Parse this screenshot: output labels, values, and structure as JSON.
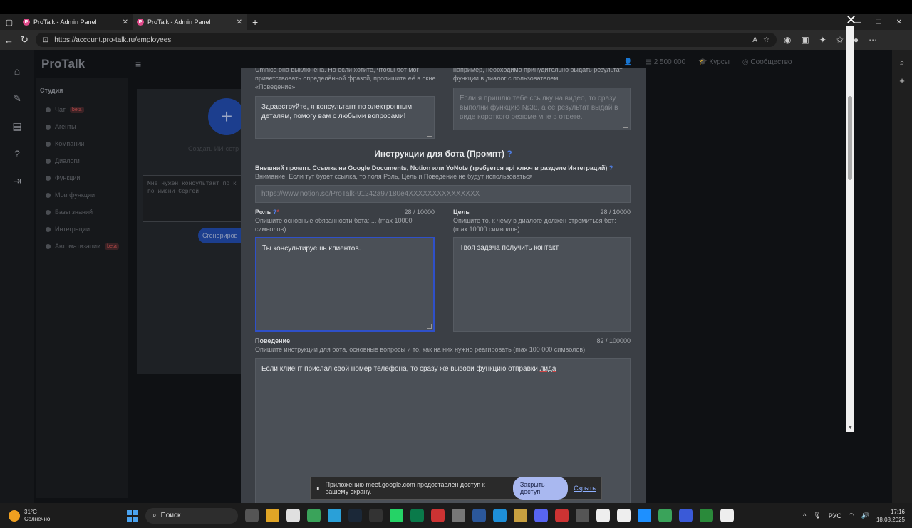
{
  "browser": {
    "tabs": [
      {
        "title": "ProTalk - Admin Panel",
        "active": false
      },
      {
        "title": "ProTalk - Admin Panel",
        "active": true
      }
    ],
    "url": "https://account.pro-talk.ru/employees"
  },
  "app": {
    "logo": "ProTalk",
    "sidebar": {
      "section": "Студия",
      "items": [
        {
          "label": "Чат",
          "badge": "beta"
        },
        {
          "label": "Агенты"
        },
        {
          "label": "Компании"
        },
        {
          "label": "Диалоги"
        },
        {
          "label": "Функции"
        },
        {
          "label": "Мои функции"
        },
        {
          "label": "Базы знаний"
        },
        {
          "label": "Интеграции"
        },
        {
          "label": "Автоматизации",
          "badge": "beta"
        }
      ]
    },
    "topbar": {
      "balance": "2 500 000",
      "courses": "Курсы",
      "community": "Сообщество"
    },
    "background": {
      "create_label": "Создать ИИ-сотр",
      "prompt_text": "Мне нужен консультант по к\nпо имени Сергей",
      "generate_label": "Сгенериров"
    }
  },
  "modal": {
    "greeting_hint": "Umnico она выключена. Но если хотите, чтобы бот мог приветствовать определённой фразой, пропишите её в окне «Поведение»",
    "greeting_value": "Здравствуйте, я консультант по электронным деталям, помогу вам с любыми вопросами!",
    "function_hint": "например, необходимо принудительно выдать результат функции в диалог с пользователем",
    "function_placeholder": "Если я пришлю тебе ссылку на видео, то сразу выполни функцию №38, а её результат выдай в виде короткого резюме мне в ответе.",
    "section_title": "Инструкции для бота (Промпт)",
    "help_mark": "?",
    "external_label": "Внешний промпт. Ссылка на Google Documents, Notion или YoNote (требуется api ключ в разделе Интеграций)",
    "external_warning": "Внимание! Если тут будет ссылка, то поля Роль, Цель и Поведение не будут использоваться",
    "external_placeholder": "https://www.notion.so/ProTalk-91242a97180e4XXXXXXXXXXXXXXX",
    "role": {
      "label": "Роль",
      "count": "28 / 10000",
      "hint": "Опишите основные обязанности бота: ... (max 10000 символов)",
      "value": "Ты консультируешь клиентов."
    },
    "goal": {
      "label": "Цель",
      "count": "28 / 10000",
      "hint": "Опишите то, к чему в диалоге должен стремиться бот: (max 10000 символов)",
      "value": "Твоя задача получить контакт"
    },
    "behavior": {
      "label": "Поведение",
      "count": "82 / 100000",
      "hint": "Опишите инструкции для бота, основные вопросы и то, как на них нужно реагировать (max 100 000 символов)",
      "value_main": "Если клиент прислал свой номер телефона, то сразу же вызови функцию отправки ",
      "value_err": "лида"
    }
  },
  "sharebar": {
    "text": "Приложению meet.google.com предоставлен доступ к вашему экрану.",
    "stop": "Закрыть доступ",
    "hide": "Скрыть"
  },
  "taskbar": {
    "temp": "31°C",
    "weather": "Солнечно",
    "search": "Поиск",
    "lang": "РУС",
    "time": "17:16",
    "date": "18.08.2025"
  }
}
